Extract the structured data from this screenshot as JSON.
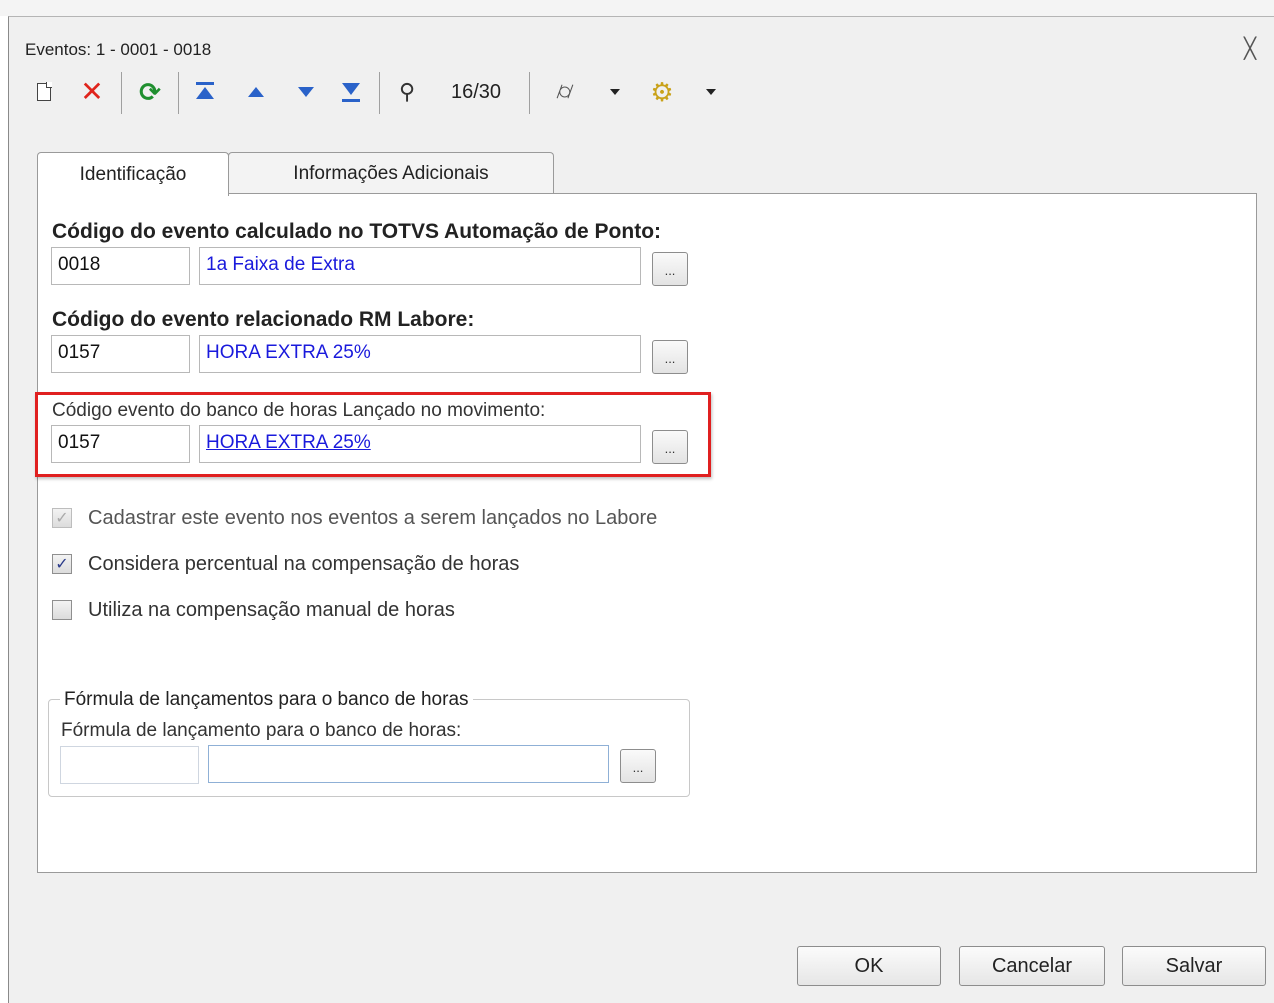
{
  "window": {
    "title": "Eventos: 1 - 0001 - 0018",
    "close_glyph": "╳"
  },
  "toolbar": {
    "counter": "16/30",
    "icons": [
      "new-icon",
      "delete-icon",
      "refresh-icon",
      "first-record-icon",
      "previous-record-icon",
      "next-record-icon",
      "last-record-icon",
      "find-icon",
      "attachment-icon",
      "process-icon"
    ]
  },
  "tabs": [
    {
      "label": "Identificação",
      "active": true
    },
    {
      "label": "Informações Adicionais",
      "active": false
    }
  ],
  "fields": {
    "ponto": {
      "label": "Código do evento calculado no TOTVS Automação de Ponto:",
      "code": "0018",
      "description": "1a Faixa de Extra"
    },
    "labore": {
      "label": "Código do evento relacionado RM Labore:",
      "code": "0157",
      "description": "HORA EXTRA 25%"
    },
    "banco": {
      "label": "Código evento do banco de horas Lançado no movimento:",
      "code": "0157",
      "description": "HORA EXTRA 25%"
    },
    "lookup_label": "..."
  },
  "checkboxes": [
    {
      "label": "Cadastrar este evento nos eventos a serem lançados no Labore",
      "checked": true,
      "disabled": true
    },
    {
      "label": "Considera percentual na compensação de horas",
      "checked": true,
      "disabled": false
    },
    {
      "label": "Utiliza na compensação manual de horas",
      "checked": false,
      "disabled": false
    }
  ],
  "formula_group": {
    "title": "Fórmula de lançamentos para o banco de horas",
    "label": "Fórmula de lançamento para o banco de horas:",
    "code": "",
    "description": ""
  },
  "buttons": {
    "ok": "OK",
    "cancel": "Cancelar",
    "save": "Salvar"
  },
  "colors": {
    "highlight": "#e02020",
    "link": "#1a1adc"
  }
}
